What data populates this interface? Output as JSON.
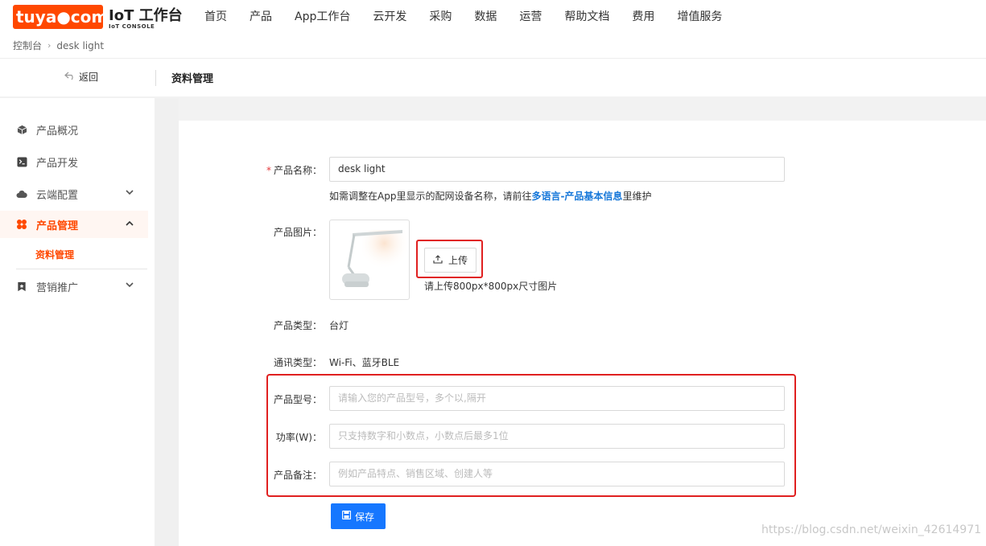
{
  "header": {
    "logo_text": "tuya●com",
    "title": "IoT 工作台",
    "subtitle": "IoT CONSOLE",
    "nav": [
      "首页",
      "产品",
      "App工作台",
      "云开发",
      "采购",
      "数据",
      "运营",
      "帮助文档",
      "费用",
      "增值服务"
    ],
    "breadcrumb": [
      "控制台",
      "desk light"
    ]
  },
  "subheader": {
    "back_label": "返回",
    "page_title": "资料管理"
  },
  "sidebar": {
    "items": [
      {
        "label": "产品概况",
        "icon": "cube-icon"
      },
      {
        "label": "产品开发",
        "icon": "terminal-icon"
      },
      {
        "label": "云端配置",
        "icon": "cloud-icon",
        "expand": "chevron-down"
      },
      {
        "label": "产品管理",
        "icon": "grid-flower-icon",
        "expand": "chevron-up",
        "active": true
      },
      {
        "label": "营销推广",
        "icon": "bookmark-star-icon",
        "expand": "chevron-down"
      }
    ],
    "sub_item": "资料管理"
  },
  "form": {
    "name_label": "产品名称",
    "name_value": "desk light",
    "name_hint_prefix": "如需调整在App里显示的配网设备名称，请前往",
    "name_hint_link": "多语言-产品基本信息",
    "name_hint_suffix": "里维护",
    "image_label": "产品图片",
    "upload_label": "上传",
    "upload_hint": "请上传800px*800px尺寸图片",
    "type_label": "产品类型",
    "type_value": "台灯",
    "comm_label": "通讯类型",
    "comm_value": "Wi-Fi、蓝牙BLE",
    "model_label": "产品型号",
    "model_placeholder": "请输入您的产品型号，多个以,隔开",
    "power_label": "功率(W)",
    "power_placeholder": "只支持数字和小数点，小数点后最多1位",
    "note_label": "产品备注",
    "note_placeholder": "例如产品特点、销售区域、创建人等",
    "save_label": "保存"
  },
  "watermark": "https://blog.csdn.net/weixin_42614971",
  "colors": {
    "brand": "#ff4800",
    "primary": "#1677ff",
    "highlight": "#e02020"
  }
}
